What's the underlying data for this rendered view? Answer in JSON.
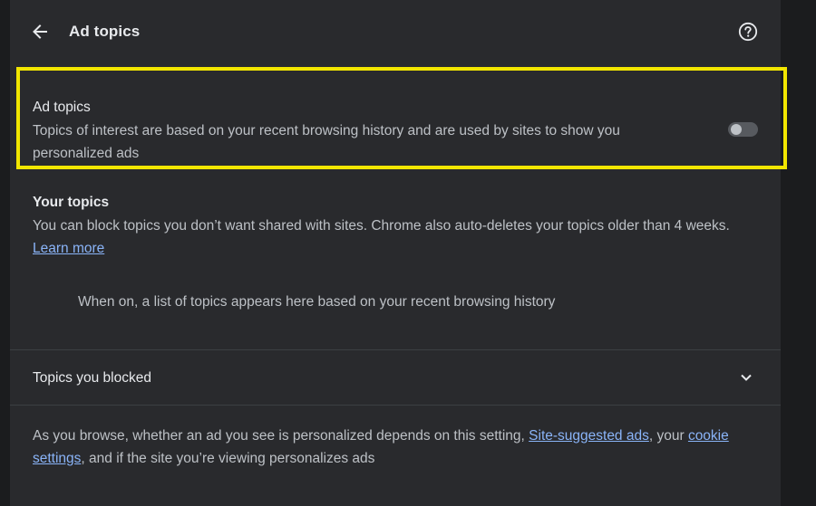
{
  "header": {
    "title": "Ad topics"
  },
  "ad_topics_setting": {
    "title": "Ad topics",
    "description": "Topics of interest are based on your recent browsing history and are used by sites to show you personalized ads",
    "toggle_on": false
  },
  "your_topics": {
    "title": "Your topics",
    "description": "You can block topics you don’t want shared with sites. Chrome also auto-deletes your topics older than 4 weeks.",
    "learn_more": "Learn more",
    "empty_state": "When on, a list of topics appears here based on your recent browsing history"
  },
  "blocked": {
    "label": "Topics you blocked"
  },
  "footer": {
    "text_1": "As you browse, whether an ad you see is personalized depends on this setting,",
    "link_site_suggested": "Site-suggested ads",
    "text_2": ", your",
    "link_cookie": "cookie settings",
    "text_3": ", and if the site you’re viewing personalizes ads"
  },
  "colors": {
    "background": "#202124",
    "card": "#292a2d",
    "highlight": "#f2e600",
    "link": "#8ab4f8"
  },
  "icons": {
    "back": "arrow-back-icon",
    "help": "help-circle-icon",
    "expand": "chevron-down-icon"
  }
}
